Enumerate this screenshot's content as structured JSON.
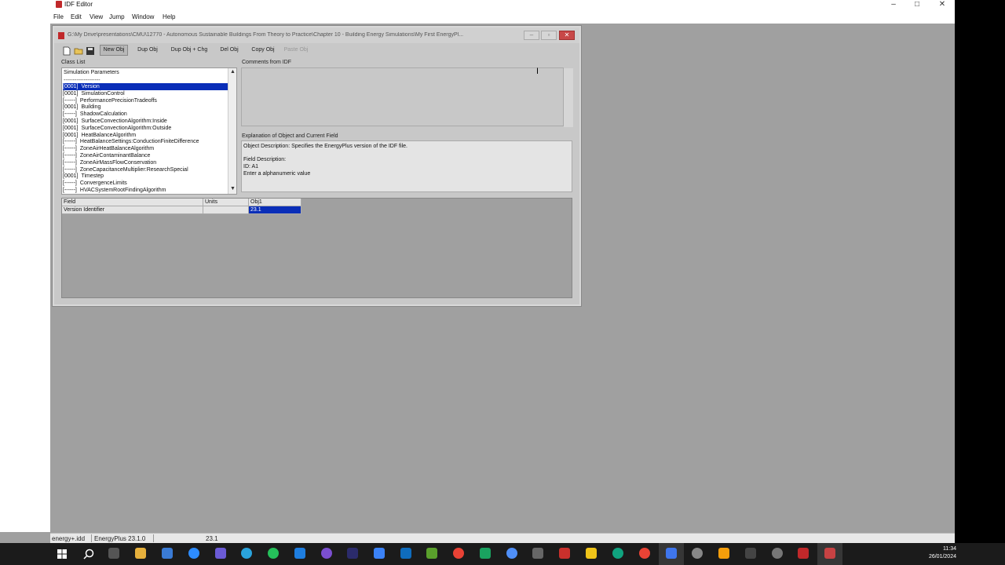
{
  "app": {
    "title": "IDF Editor",
    "menu": [
      "File",
      "Edit",
      "View",
      "Jump",
      "Window",
      "Help"
    ]
  },
  "child_window": {
    "title": "G:\\My Drive\\presentations\\CMU\\12770 - Autonomous Sustainable Buildings From Theory to Practice\\Chapter 10 - Building Energy Simulations\\My First EnergyPl...",
    "toolbar": {
      "new_obj": "New Obj",
      "dup_obj": "Dup Obj",
      "dup_obj_chg": "Dup Obj + Chg",
      "del_obj": "Del Obj",
      "copy_obj": "Copy Obj",
      "paste_obj": "Paste Obj"
    },
    "class_list_label": "Class List",
    "class_list_header": "Simulation Parameters",
    "class_list_separator": "--------------------",
    "class_list": [
      {
        "count": "[0001]",
        "name": "Version",
        "selected": true
      },
      {
        "count": "[0001]",
        "name": "SimulationControl"
      },
      {
        "count": "[------]",
        "name": "PerformancePrecisionTradeoffs"
      },
      {
        "count": "[0001]",
        "name": "Building"
      },
      {
        "count": "[------]",
        "name": "ShadowCalculation"
      },
      {
        "count": "[0001]",
        "name": "SurfaceConvectionAlgorithm:Inside"
      },
      {
        "count": "[0001]",
        "name": "SurfaceConvectionAlgorithm:Outside"
      },
      {
        "count": "[0001]",
        "name": "HeatBalanceAlgorithm"
      },
      {
        "count": "[------]",
        "name": "HeatBalanceSettings:ConductionFiniteDifference"
      },
      {
        "count": "[------]",
        "name": "ZoneAirHeatBalanceAlgorithm"
      },
      {
        "count": "[------]",
        "name": "ZoneAirContaminantBalance"
      },
      {
        "count": "[------]",
        "name": "ZoneAirMassFlowConservation"
      },
      {
        "count": "[------]",
        "name": "ZoneCapacitanceMultiplier:ResearchSpecial"
      },
      {
        "count": "[0001]",
        "name": "Timestep"
      },
      {
        "count": "[------]",
        "name": "ConvergenceLimits"
      },
      {
        "count": "[------]",
        "name": "HVACSystemRootFindingAlgorithm"
      }
    ],
    "comments_label": "Comments from IDF",
    "explanation_label": "Explanation of Object and Current Field",
    "explanation": {
      "object_description": "Object Description: Specifies the EnergyPlus version of the IDF file.",
      "field_description": "Field Description:",
      "id": "ID: A1",
      "hint": "Enter a alphanumeric value"
    },
    "grid": {
      "headers": [
        "Field",
        "Units",
        "Obj1"
      ],
      "rows": [
        {
          "field": "Version Identifier",
          "units": "",
          "obj1": "23.1"
        }
      ]
    }
  },
  "statusbar": {
    "idd": "energy+.idd",
    "version": "EnergyPlus 23.1.0",
    "value": "23.1"
  },
  "taskbar": {
    "time": "11:34",
    "date": "26/01/2024"
  }
}
